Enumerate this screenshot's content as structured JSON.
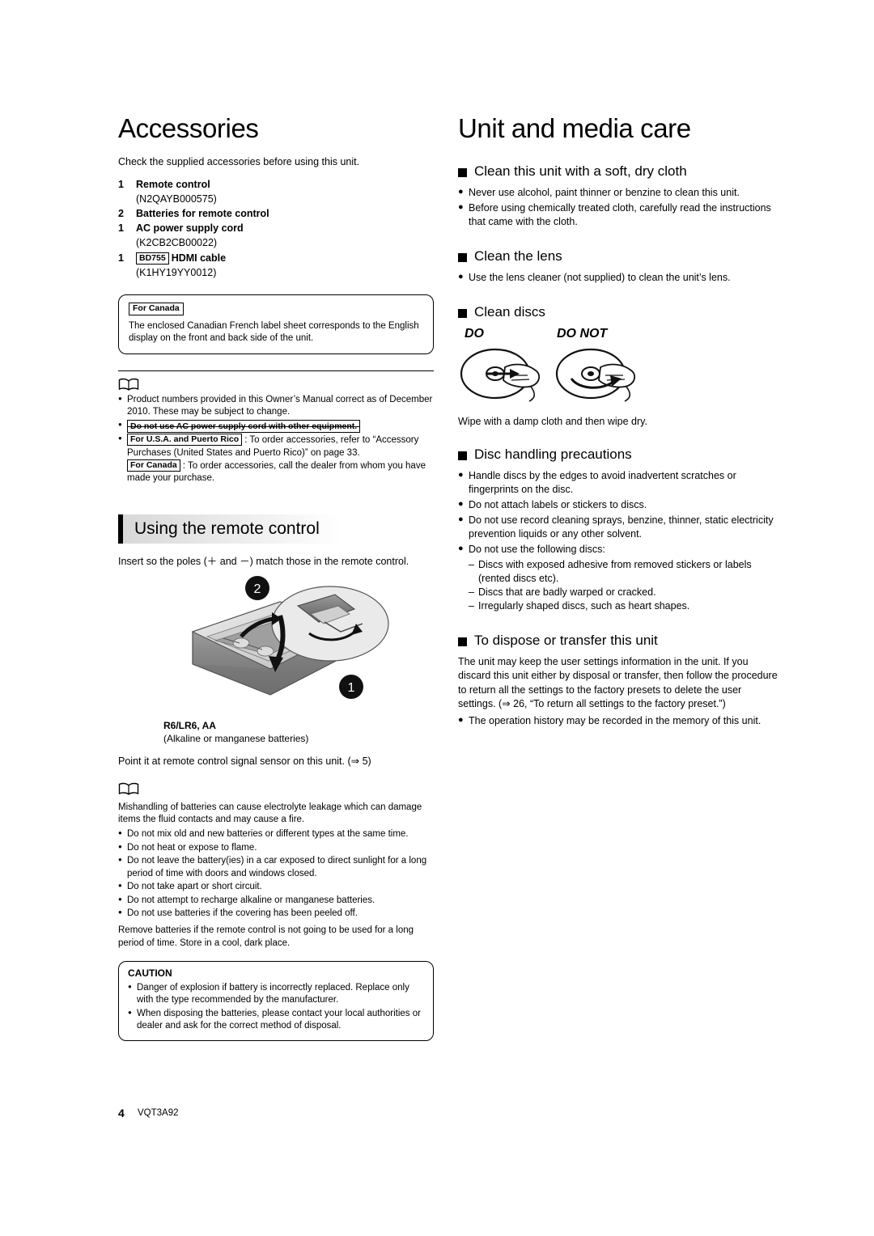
{
  "left": {
    "title": "Accessories",
    "intro": "Check the supplied accessories before using this unit.",
    "accessories": [
      {
        "num": "1",
        "label": "Remote control",
        "sub": "(N2QAYB000575)"
      },
      {
        "num": "2",
        "label": "Batteries for remote control",
        "sub": ""
      },
      {
        "num": "1",
        "label": "AC power supply cord",
        "sub": "(K2CB2CB00022)"
      },
      {
        "num": "1",
        "badge": "BD755",
        "label": "HDMI cable",
        "sub": "(K1HY19YY0012)"
      }
    ],
    "canada_box": {
      "label": "For Canada",
      "text": "The enclosed Canadian French label sheet corresponds to the English display on the front and back side of the unit."
    },
    "notes": [
      "Product numbers provided in this Owner’s Manual correct as of December 2010. These may be subject to change.",
      "Do not use AC power supply cord with other equipment."
    ],
    "order_note": {
      "usa_label": "For U.S.A. and Puerto Rico",
      "usa_text": ": To order accessories, refer to “Accessory Purchases (United States and Puerto Rico)” on page 33.",
      "canada_label": "For Canada",
      "canada_text": ": To order accessories, call the dealer from whom you have made your purchase."
    },
    "remote_section": {
      "heading": "Using the remote control",
      "body": "Insert so the poles (＋ and －) match those in the remote control.",
      "callout_1": "1",
      "callout_2": "2",
      "battery_type": "R6/LR6, AA",
      "battery_desc": "(Alkaline or manganese batteries)",
      "point_note": "Point it at remote control signal sensor on this unit. (⇒ 5)",
      "battery_notes_intro": "Mishandling of batteries can cause electrolyte leakage which can damage items the fluid contacts and may cause a fire.",
      "battery_notes": [
        "Do not mix old and new batteries or different types at the same time.",
        "Do not heat or expose to flame.",
        "Do not leave the battery(ies) in a car exposed to direct sunlight for a long period of time with doors and windows closed.",
        "Do not take apart or short circuit.",
        "Do not attempt to recharge alkaline or manganese batteries.",
        "Do not use batteries if the covering has been peeled off."
      ],
      "battery_outro": "Remove batteries if the remote control is not going to be used for a long period of time. Store in a cool, dark place.",
      "caution_title": "CAUTION",
      "caution_items": [
        "Danger of explosion if battery is incorrectly replaced. Replace only with the type recommended by the manufacturer.",
        "When disposing the batteries, please contact your local authorities or dealer and ask for the correct method of disposal."
      ]
    }
  },
  "right": {
    "title": "Unit and media care",
    "sections": [
      {
        "heading": "Clean this unit with a soft, dry cloth",
        "bullets": [
          "Never use alcohol, paint thinner or benzine to clean this unit.",
          "Before using chemically treated cloth, carefully read the instructions that came with the cloth."
        ]
      },
      {
        "heading": "Clean the lens",
        "bullets": [
          "Use the lens cleaner (not supplied) to clean the unit’s lens."
        ]
      },
      {
        "heading": "Clean discs",
        "do_label": "DO",
        "donot_label": "DO NOT",
        "caption": "Wipe with a damp cloth and then wipe dry."
      },
      {
        "heading": "Disc handling precautions",
        "bullets": [
          "Handle discs by the edges to avoid inadvertent scratches or fingerprints on the disc.",
          "Do not attach labels or stickers to discs.",
          "Do not use record cleaning sprays, benzine, thinner, static electricity prevention liquids or any other solvent.",
          "Do not use the following discs:"
        ],
        "sub_bullets": [
          "Discs with exposed adhesive from removed stickers or labels (rented discs etc).",
          "Discs that are badly warped or cracked.",
          "Irregularly shaped discs, such as heart shapes."
        ]
      },
      {
        "heading": "To dispose or transfer this unit",
        "body": "The unit may keep the user settings information in the unit. If you discard this unit either by disposal or transfer, then follow the procedure to return all the settings to the factory presets to delete the user settings. (⇒ 26, “To return all settings to the factory preset.”)",
        "bullets": [
          "The operation history may be recorded in the memory of this unit."
        ]
      }
    ]
  },
  "footer": {
    "page_number": "4",
    "doc_code": "VQT3A92"
  }
}
